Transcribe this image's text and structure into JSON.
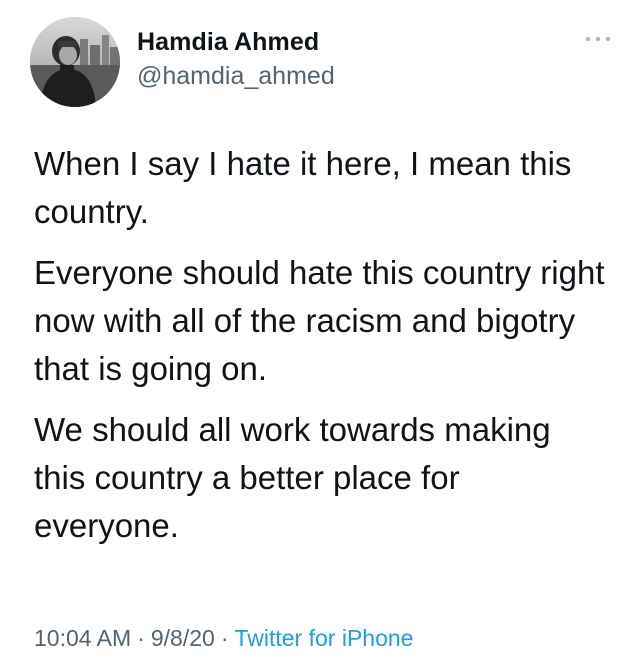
{
  "author": {
    "display_name": "Hamdia Ahmed",
    "handle": "@hamdia_ahmed"
  },
  "tweet": {
    "paragraphs": [
      "When I say I hate it here, I mean this country.",
      "Everyone should hate this country right now with all of the racism and bigotry that is going on.",
      "We should all work towards making this country a better place for everyone."
    ],
    "time": "10:04 AM",
    "date": "9/8/20",
    "source": "Twitter for iPhone",
    "separator": "·"
  },
  "icons": {
    "more": "more-options-icon",
    "avatar": "avatar-photo"
  },
  "colors": {
    "text": "#0f1419",
    "secondary": "#536471",
    "link": "#1d9bf0"
  }
}
